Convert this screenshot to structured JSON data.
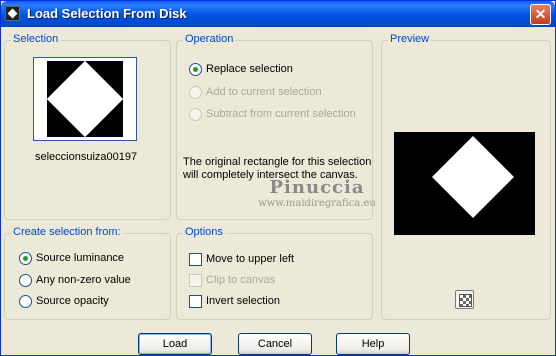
{
  "window": {
    "title": "Load Selection From Disk",
    "close_glyph": "✕"
  },
  "selection": {
    "label": "Selection",
    "filename": "seleccionsuiza00197"
  },
  "operation": {
    "label": "Operation",
    "options": [
      {
        "label": "Replace selection",
        "checked": true,
        "enabled": true
      },
      {
        "label": "Add to current selection",
        "checked": false,
        "enabled": false
      },
      {
        "label": "Subtract from current selection",
        "checked": false,
        "enabled": false
      }
    ],
    "info": "The original rectangle for this selection will completely intersect the canvas."
  },
  "preview": {
    "label": "Preview"
  },
  "create_from": {
    "label": "Create selection from:",
    "options": [
      {
        "label": "Source luminance",
        "checked": true
      },
      {
        "label": "Any non-zero value",
        "checked": false
      },
      {
        "label": "Source opacity",
        "checked": false
      }
    ]
  },
  "options": {
    "label": "Options",
    "items": [
      {
        "label": "Move to upper left",
        "checked": false,
        "enabled": true
      },
      {
        "label": "Clip to canvas",
        "checked": false,
        "enabled": false
      },
      {
        "label": "Invert selection",
        "checked": false,
        "enabled": true
      }
    ]
  },
  "watermark": {
    "name": "Pinuccia",
    "site": "www.maidiregrafica.eu"
  },
  "buttons": {
    "load": "Load",
    "cancel": "Cancel",
    "help": "Help"
  },
  "icons": {
    "app": "selection-app-icon",
    "close": "close-icon",
    "zoom": "checkerboard-zoom-icon"
  }
}
